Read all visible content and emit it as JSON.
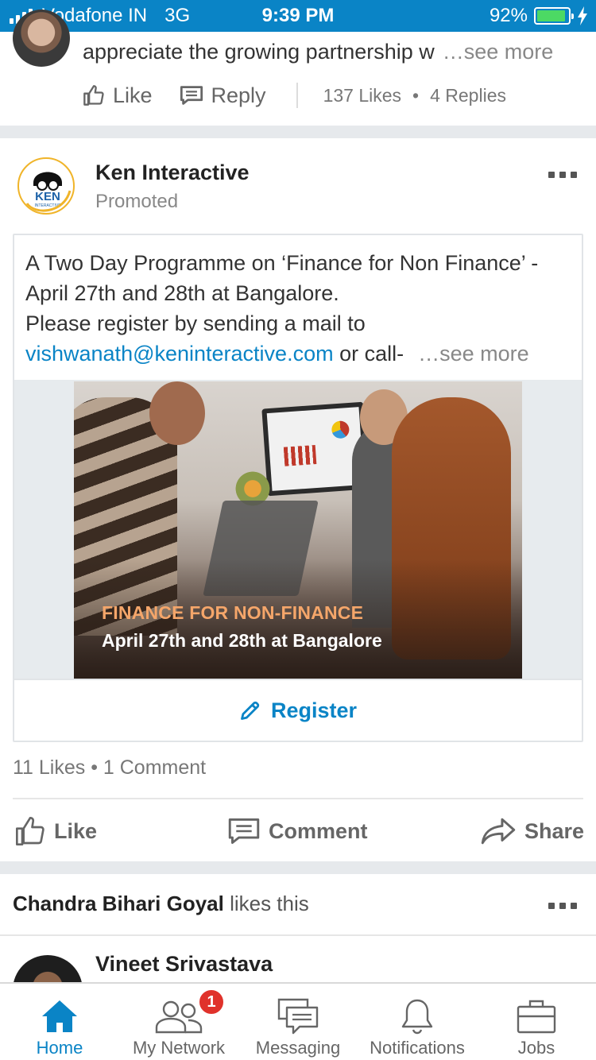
{
  "status_bar": {
    "carrier": "Vodafone IN",
    "network": "3G",
    "time": "9:39 PM",
    "battery_text": "92%",
    "battery_level": 0.92,
    "accent": "#0a84c6"
  },
  "previous_comment": {
    "text": "appreciate the growing partnership w",
    "see_more": "…see more",
    "like_label": "Like",
    "reply_label": "Reply",
    "likes_count": "137 Likes",
    "separator": "•",
    "replies_count": "4 Replies"
  },
  "post": {
    "author": "Ken Interactive",
    "subtitle": "Promoted",
    "logo_text": "KEN",
    "logo_subtext": "INTERACTIVE",
    "text_line1": "A Two Day Programme on ‘Finance for Non Finance’ -",
    "text_line2": "April 27th and 28th at Bangalore.",
    "text_line3": "Please register by sending a mail to",
    "email_link": "vishwanath@keninteractive.com",
    "text_tail": " or call-",
    "see_more": "…see more",
    "image_heading": "FINANCE FOR NON-FINANCE",
    "image_subheading": "April 27th and 28th at Bangalore",
    "cta_label": "Register",
    "stats": "11 Likes • 1 Comment",
    "actions": {
      "like": "Like",
      "comment": "Comment",
      "share": "Share"
    }
  },
  "next_post": {
    "liker_name": "Chandra Bihari Goyal",
    "liker_suffix": " likes this",
    "author": "Vineet Srivastava"
  },
  "tab_bar": {
    "tabs": [
      {
        "label": "Home",
        "icon": "home-icon",
        "active": true
      },
      {
        "label": "My Network",
        "icon": "network-icon",
        "badge": "1"
      },
      {
        "label": "Messaging",
        "icon": "messaging-icon"
      },
      {
        "label": "Notifications",
        "icon": "bell-icon"
      },
      {
        "label": "Jobs",
        "icon": "briefcase-icon"
      }
    ]
  },
  "colors": {
    "brand": "#0a84c6",
    "badge": "#e0322b",
    "image_heading": "#f5a66a"
  }
}
